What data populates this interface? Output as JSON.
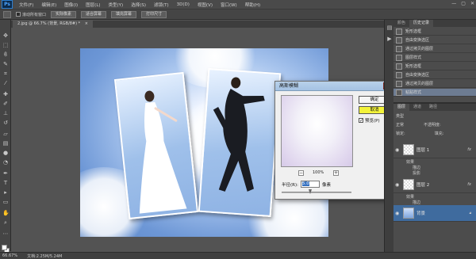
{
  "app": {
    "logo": "Ps"
  },
  "menu": {
    "items": [
      "文件(F)",
      "编辑(E)",
      "图像(I)",
      "图层(L)",
      "类型(Y)",
      "选择(S)",
      "滤镜(T)",
      "3D(D)",
      "视图(V)",
      "窗口(W)",
      "帮助(H)"
    ]
  },
  "window_controls": {
    "minimize": "—",
    "restore": "▢",
    "close": "✕"
  },
  "options": {
    "checkbox_label": "滚动所有窗口",
    "buttons": [
      "实际像素",
      "适合屏幕",
      "填充屏幕",
      "打印尺寸"
    ]
  },
  "document": {
    "tab_label": "2.jpg @ 66.7% (背景, RGB/8#) *",
    "close": "×"
  },
  "statusbar": {
    "zoom": "66.67%",
    "doc_info": "文档:2.25M/5.24M"
  },
  "history": {
    "tabs": [
      "颜色",
      "历史记录"
    ],
    "items": [
      {
        "label": "矩形选框",
        "selected": false
      },
      {
        "label": "自由变换选区",
        "selected": false
      },
      {
        "label": "通过拷贝的图层",
        "selected": false
      },
      {
        "label": "图层样式",
        "selected": false
      },
      {
        "label": "矩形选框",
        "selected": false
      },
      {
        "label": "自由变换选区",
        "selected": false
      },
      {
        "label": "通过拷贝的图层",
        "selected": false
      },
      {
        "label": "粘贴样式",
        "selected": true
      }
    ]
  },
  "layers": {
    "tabs": [
      "图层",
      "通道",
      "路径"
    ],
    "kind_label": "类型",
    "blend_mode": "正常",
    "opacity_label": "不透明度:",
    "lock_label": "锁定:",
    "fill_label": "填充:",
    "list": [
      {
        "name": "图层 1",
        "fx": "fx",
        "effects_label": "效果",
        "effects": [
          "描边",
          "投影"
        ],
        "selected": false
      },
      {
        "name": "图层 2",
        "fx": "fx",
        "effects_label": "效果",
        "effects": [
          "描边",
          "投影"
        ],
        "selected": false
      },
      {
        "name": "背景",
        "fx": "",
        "effects_label": "",
        "effects": [],
        "selected": true
      }
    ]
  },
  "dialog": {
    "title": "高斯模糊",
    "ok": "确定",
    "cancel": "取消",
    "preview_label": "预览(P)",
    "preview_checked": "✓",
    "zoom_out": "−",
    "zoom_in": "+",
    "zoom_pct": "100%",
    "radius_label": "半径(R):",
    "radius_value": "5.0",
    "radius_unit": "像素",
    "close": "×"
  },
  "colors": {
    "highlight": "#1fa33b",
    "accent": "#3f6b9e"
  }
}
